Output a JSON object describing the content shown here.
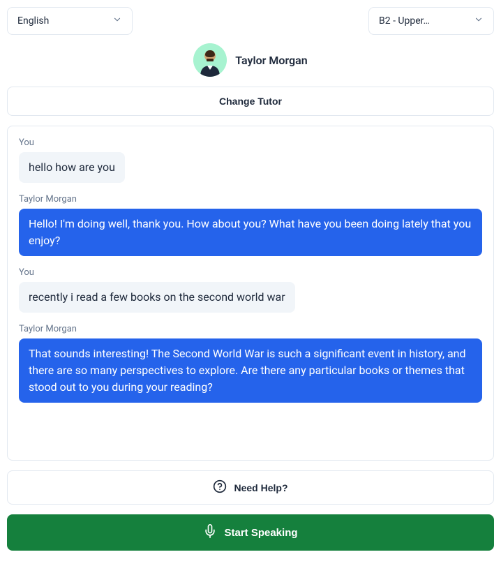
{
  "dropdowns": {
    "language": "English",
    "level": "B2 - Upper…"
  },
  "tutor": {
    "name": "Taylor Morgan"
  },
  "buttons": {
    "change_tutor": "Change Tutor",
    "need_help": "Need Help?",
    "start_speaking": "Start Speaking"
  },
  "messages": [
    {
      "sender": "You",
      "role": "user",
      "text": "hello how are you"
    },
    {
      "sender": "Taylor Morgan",
      "role": "tutor",
      "text": "Hello! I'm doing well, thank you. How about you? What have you been doing lately that you enjoy?"
    },
    {
      "sender": "You",
      "role": "user",
      "text": "recently i read a few books on the second world war"
    },
    {
      "sender": "Taylor Morgan",
      "role": "tutor",
      "text": "That sounds interesting! The Second World War is such a significant event in history, and there are so many perspectives to explore. Are there any particular books or themes that stood out to you during your reading?"
    }
  ]
}
